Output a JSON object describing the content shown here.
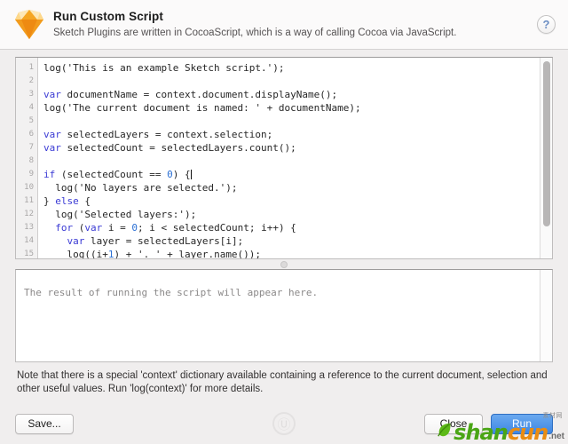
{
  "header": {
    "title": "Run Custom Script",
    "subtitle": "Sketch Plugins are written in CocoaScript, which is a way of calling Cocoa via JavaScript.",
    "logo_icon": "sketch-diamond-icon",
    "help_icon": "help-question-icon",
    "help_label": "?"
  },
  "editor": {
    "line_numbers": [
      "1",
      "2",
      "3",
      "4",
      "5",
      "6",
      "7",
      "8",
      "9",
      "10",
      "11",
      "12",
      "13",
      "14",
      "15"
    ],
    "lines": [
      "log('This is an example Sketch script.');",
      "",
      "var documentName = context.document.displayName();",
      "log('The current document is named: ' + documentName);",
      "",
      "var selectedLayers = context.selection;",
      "var selectedCount = selectedLayers.count();",
      "",
      "if (selectedCount == 0) {",
      "  log('No layers are selected.');",
      "} else {",
      "  log('Selected layers:');",
      "  for (var i = 0; i < selectedCount; i++) {",
      "    var layer = selectedLayers[i];",
      "    log((i+1) + '. ' + layer.name());"
    ],
    "caret_line": 9,
    "scrollbar": "vertical-scrollbar"
  },
  "result": {
    "placeholder": "The result of running the script will appear here.",
    "value": ""
  },
  "note": {
    "line1": "Note that there is a special 'context' dictionary available containing a reference to the current document, selection and",
    "line2": "other useful values. Run 'log(context)' for more details."
  },
  "footer": {
    "save_label": "Save...",
    "close_label": "Close",
    "run_label": "Run"
  },
  "watermark": {
    "center_glyph": "Ⓤ",
    "brand_part1": "shan",
    "brand_part2": "cun",
    "brand_tld": ".net",
    "brand_cn": "素材网"
  },
  "colors": {
    "accent": "#3f87e4",
    "keyword": "#3a3ad4",
    "number": "#2a6fd4",
    "logo": "#f5a623"
  }
}
